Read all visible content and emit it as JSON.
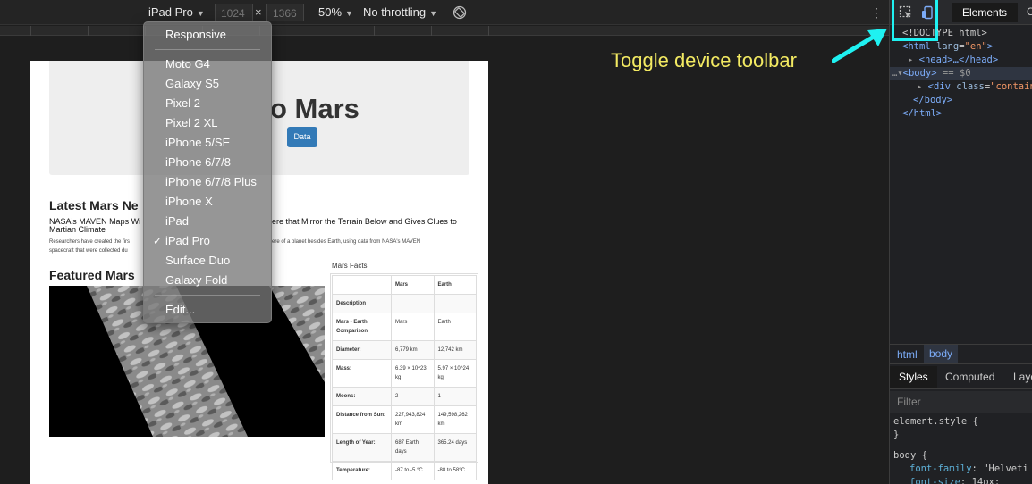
{
  "device_toolbar": {
    "device": "iPad Pro",
    "width": "1024",
    "height": "1366",
    "separator": "×",
    "zoom": "50%",
    "throttling": "No throttling"
  },
  "device_menu": {
    "responsive": "Responsive",
    "devices": [
      "Moto G4",
      "Galaxy S5",
      "Pixel 2",
      "Pixel 2 XL",
      "iPhone 5/SE",
      "iPhone 6/7/8",
      "iPhone 6/7/8 Plus",
      "iPhone X",
      "iPad",
      "iPad Pro",
      "Surface Duo",
      "Galaxy Fold"
    ],
    "selected_index": 9,
    "edit": "Edit..."
  },
  "annotation": {
    "text": "Toggle device toolbar",
    "color": "#f3ea62",
    "highlight_color": "#1ff1f1"
  },
  "page": {
    "jumbotron_title": "o Mars",
    "jumbotron_button": "Data",
    "news_heading": "Latest Mars Ne",
    "news_title_left": "NASA's MAVEN Maps Wi",
    "news_title_right": "ere that Mirror the Terrain Below and Gives Clues to",
    "news_title_line2": "Martian Climate",
    "news_para_left": "Researchers have created the firs",
    "news_para_right": "ere of a planet besides Earth, using data from NASA's MAVEN",
    "news_para_line2": "spacecraft that were collected du",
    "featured_heading": "Featured Mars",
    "facts_caption": "Mars Facts",
    "facts_header": [
      "",
      "Mars",
      "Earth"
    ],
    "facts_rows": [
      [
        "Description",
        "",
        ""
      ],
      [
        "Mars - Earth Comparison",
        "Mars",
        "Earth"
      ],
      [
        "Diameter:",
        "6,779 km",
        "12,742 km"
      ],
      [
        "Mass:",
        "6.39 × 10^23 kg",
        "5.97 × 10^24 kg"
      ],
      [
        "Moons:",
        "2",
        "1"
      ],
      [
        "Distance from Sun:",
        "227,943,824 km",
        "149,598,262 km"
      ],
      [
        "Length of Year:",
        "687 Earth days",
        "365.24 days"
      ],
      [
        "Temperature:",
        "-87 to -5 °C",
        "-88 to 58°C"
      ]
    ]
  },
  "devtools": {
    "tab_elements": "Elements",
    "tab_next": "C",
    "code_lines": [
      "<!DOCTYPE html>"
    ],
    "html_tag": "<html",
    "html_attr": "lang",
    "html_attr_val": "\"en\"",
    "head_line": "<head>…</head>",
    "body_open": "<body>",
    "body_eq": "== $0",
    "div_line": "<div ",
    "div_attr": "class",
    "div_val": "\"contain",
    "body_close": "</body>",
    "html_close": "</html>",
    "crumb_html": "html",
    "crumb_body": "body",
    "sub_tabs": [
      "Styles",
      "Computed",
      "Layo"
    ],
    "filter": "Filter",
    "element_style": "element.style {",
    "brace_close": "}",
    "body_selector": "body {",
    "font_family_prop": "font-family",
    "font_family_val": "\"Helveti",
    "font_size_prop": "font-size",
    "font_size_val": "14px;"
  }
}
